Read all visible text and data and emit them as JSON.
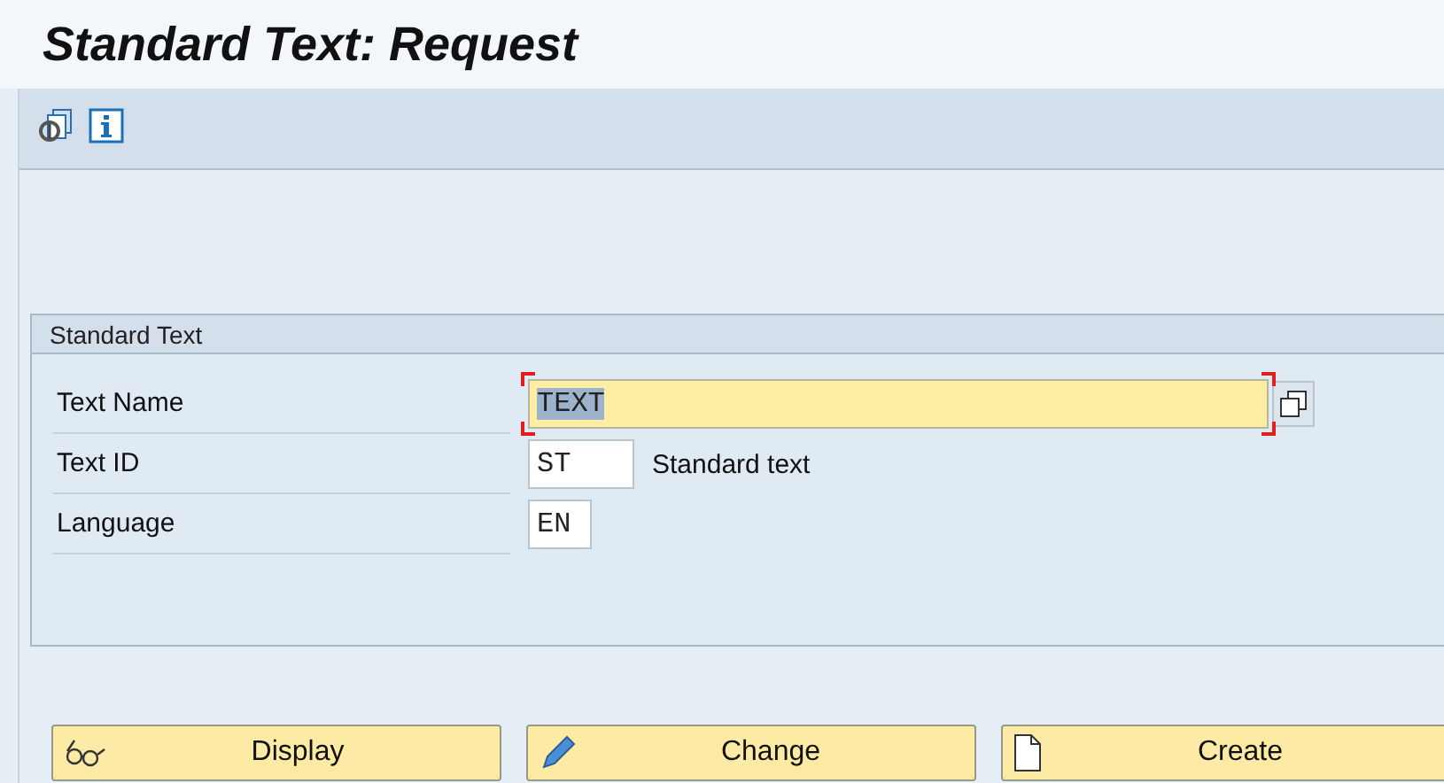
{
  "window": {
    "title": "Standard Text: Request"
  },
  "toolbar": {
    "buttons": [
      {
        "kind": "other-objects"
      },
      {
        "kind": "info"
      }
    ]
  },
  "group": {
    "title": "Standard Text",
    "fields": [
      {
        "label": "Text Name",
        "value": "TEXT",
        "focused": true,
        "value_help": true
      },
      {
        "label": "Text ID",
        "value": "ST",
        "focused": false,
        "value_help": false,
        "description": "Standard text"
      },
      {
        "label": "Language",
        "value": "EN",
        "focused": false,
        "value_help": false
      }
    ]
  },
  "buttons": [
    {
      "kind": "display",
      "label": "Display"
    },
    {
      "kind": "change",
      "label": "Change"
    },
    {
      "kind": "create",
      "label": "Create"
    }
  ]
}
